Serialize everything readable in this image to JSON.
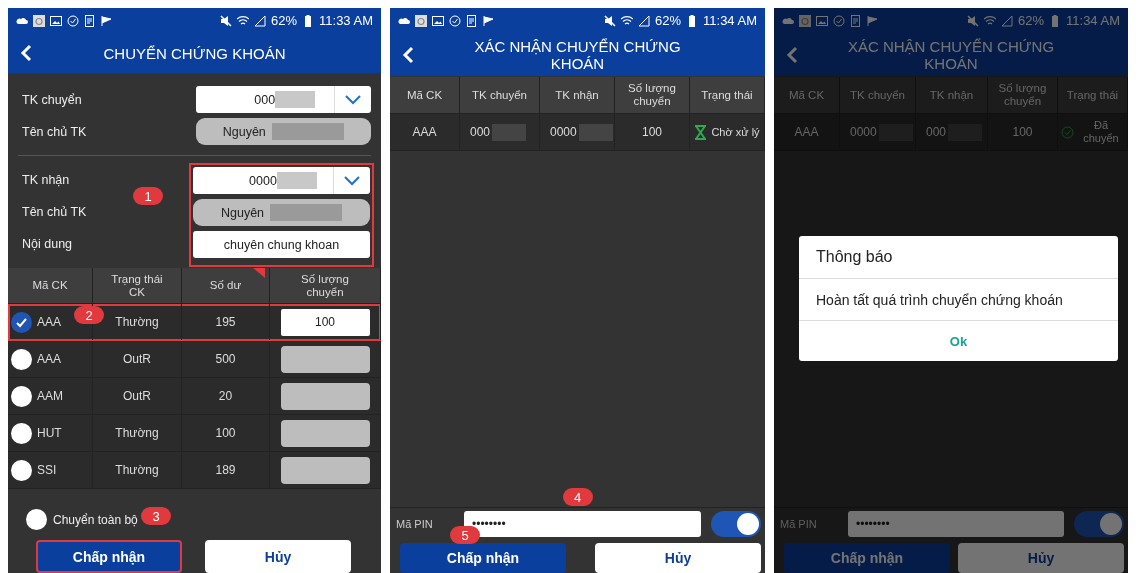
{
  "screens": [
    {
      "kind": "transfer",
      "status_bar": {
        "battery": "62%",
        "time": "11:33 AM"
      },
      "header": {
        "title": "CHUYỂN CHỨNG KHOÁN"
      },
      "sender": {
        "account_label": "TK chuyển",
        "account_value": "000",
        "owner_label": "Tên chủ TK",
        "owner_value": "Nguyên"
      },
      "receiver": {
        "highlighted": true,
        "marker": "1",
        "account_label": "TK nhận",
        "account_value": "0000",
        "owner_label": "Tên chủ TK",
        "owner_value": "Nguyên",
        "content_label": "Nội dung",
        "content_value": "chuyên chung khoan"
      },
      "table": {
        "columns": [
          "Mã CK",
          "Trạng thái CK",
          "Số dư",
          "Số lượng chuyển"
        ],
        "rows": [
          {
            "selected": true,
            "highlighted": true,
            "marker": "2",
            "code": "AAA",
            "status": "Thường",
            "balance": "195",
            "quantity": "100"
          },
          {
            "selected": false,
            "highlighted": false,
            "code": "AAA",
            "status": "OutR",
            "balance": "500"
          },
          {
            "selected": false,
            "highlighted": false,
            "code": "AAM",
            "status": "OutR",
            "balance": "20"
          },
          {
            "selected": false,
            "highlighted": false,
            "code": "HUT",
            "status": "Thường",
            "balance": "100"
          },
          {
            "selected": false,
            "highlighted": false,
            "code": "SSI",
            "status": "Thường",
            "balance": "189"
          }
        ]
      },
      "transfer_all": {
        "label": "Chuyển toàn bộ",
        "checked": false,
        "marker": "3"
      },
      "buttons": [
        {
          "label": "Chấp nhận",
          "kind": "primary",
          "highlighted": true
        },
        {
          "label": "Hủy",
          "kind": "secondary",
          "highlighted": false
        }
      ]
    },
    {
      "kind": "confirm",
      "status_bar": {
        "battery": "62%",
        "time": "11:34 AM"
      },
      "header": {
        "title": "XÁC NHẬN CHUYỂN CHỨNG KHOÁN"
      },
      "table": {
        "columns": [
          "Mã CK",
          "TK chuyển",
          "TK nhận",
          "Số lượng chuyển",
          "Trạng thái"
        ],
        "rows": [
          {
            "code": "AAA",
            "from": "000",
            "to": "0000",
            "quantity": "100",
            "status": "Chờ xử lý",
            "kind": "pending"
          }
        ]
      },
      "pin": {
        "label": "Mã PIN",
        "value": "••••••••",
        "marker": "4"
      },
      "save_pin": {
        "on": true
      },
      "buttons": [
        {
          "label": "Chấp nhận",
          "kind": "primary",
          "highlighted": false,
          "marker": "5"
        },
        {
          "label": "Hủy",
          "kind": "secondary",
          "highlighted": false
        }
      ]
    },
    {
      "kind": "confirm",
      "status_bar": {
        "battery": "62%",
        "time": "11:34 AM"
      },
      "header": {
        "title": "XÁC NHẬN CHUYỂN CHỨNG KHOÁN"
      },
      "table": {
        "columns": [
          "Mã CK",
          "TK chuyển",
          "TK nhận",
          "Số lượng chuyển",
          "Trạng thái"
        ],
        "rows": [
          {
            "code": "AAA",
            "from": "0000",
            "to": "000",
            "quantity": "100",
            "status": "Đã chuyển",
            "kind": "done"
          }
        ]
      },
      "pin": {
        "label": "Mã PIN",
        "value": "••••••••"
      },
      "save_pin": {
        "on": true
      },
      "buttons": [
        {
          "label": "Chấp nhận",
          "kind": "primary",
          "highlighted": false
        },
        {
          "label": "Hủy",
          "kind": "secondary",
          "highlighted": false
        }
      ],
      "dialog": {
        "title": "Thông báo",
        "message": "Hoàn tất quá trình chuyển chứng khoán",
        "button": "Ok"
      }
    }
  ]
}
